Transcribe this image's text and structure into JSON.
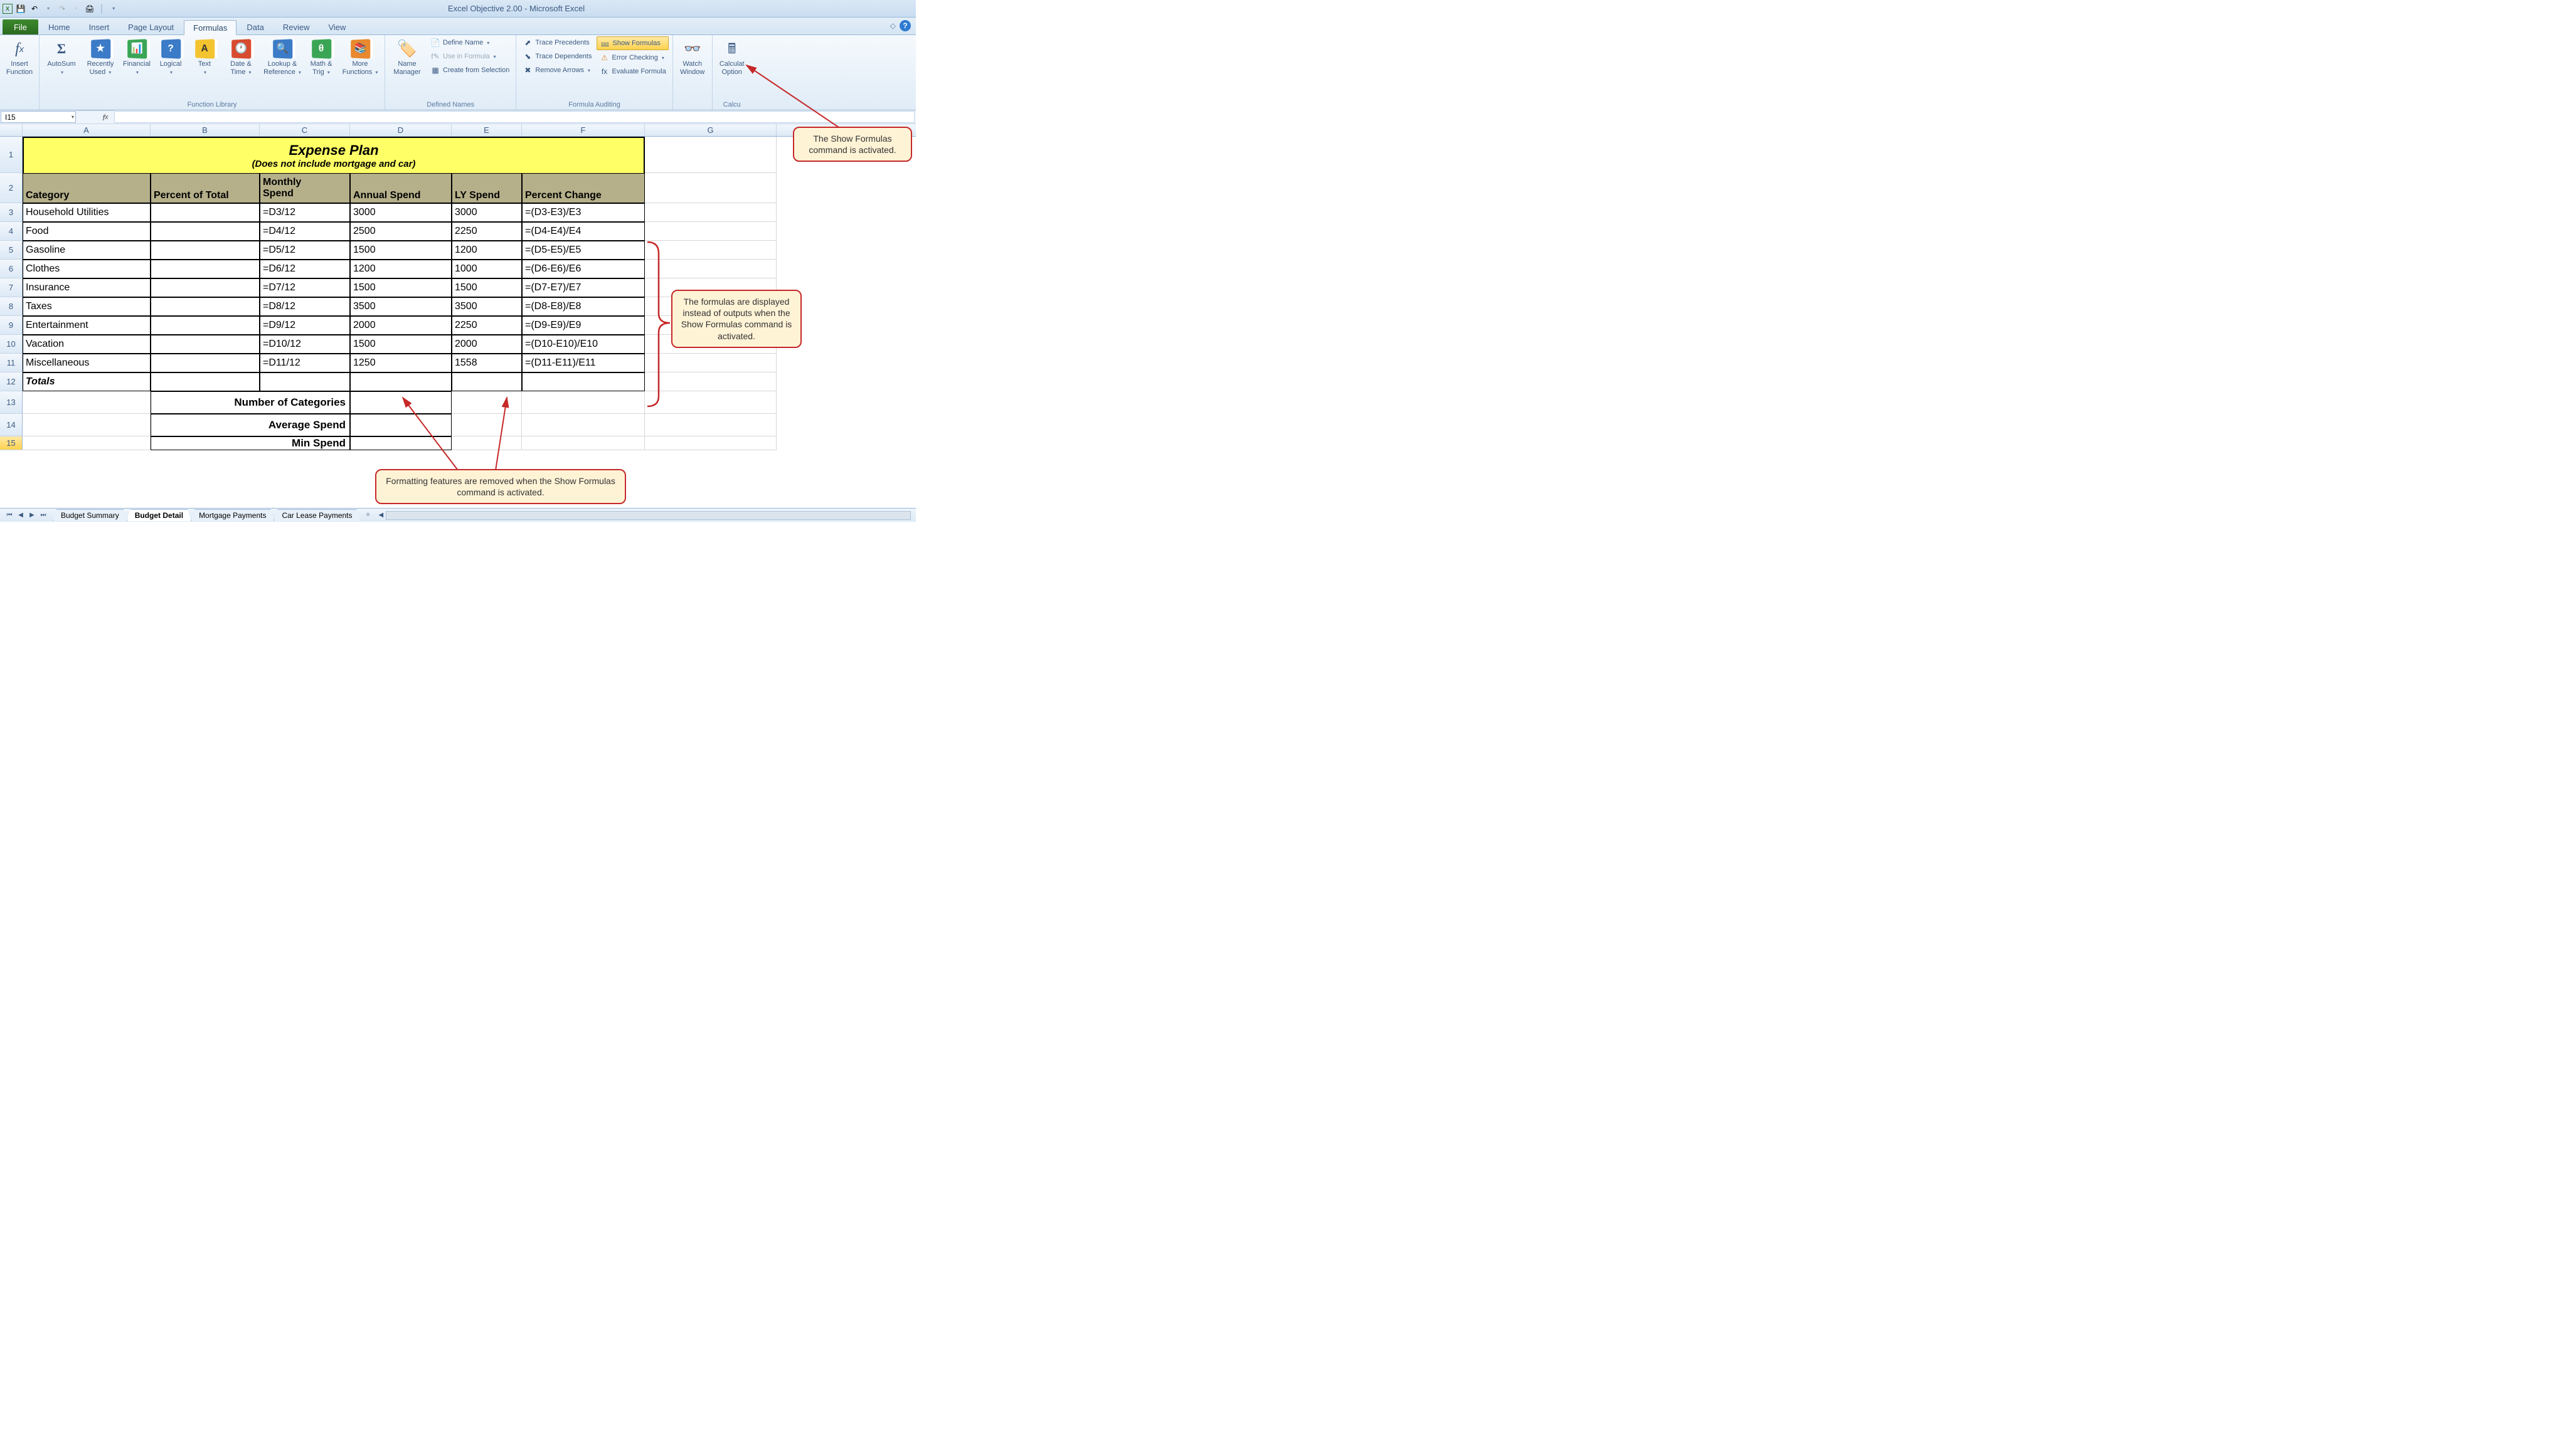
{
  "title": "Excel Objective 2.00 - Microsoft Excel",
  "qat": {
    "save": "💾",
    "undo": "↶",
    "redo": "↷",
    "print": "🖨"
  },
  "tabs": {
    "file": "File",
    "items": [
      "Home",
      "Insert",
      "Page Layout",
      "Formulas",
      "Data",
      "Review",
      "View"
    ],
    "active": "Formulas"
  },
  "ribbon": {
    "insertFn": {
      "label": "Insert\nFunction",
      "icon": "fx"
    },
    "lib": {
      "group": "Function Library",
      "autosum": "AutoSum",
      "autosum_sym": "Σ",
      "recent": "Recently\nUsed",
      "financial": "Financial",
      "logical": "Logical",
      "text": "Text",
      "datetime": "Date &\nTime",
      "lookup": "Lookup &\nReference",
      "math": "Math &\nTrig",
      "more": "More\nFunctions"
    },
    "names": {
      "group": "Defined Names",
      "mgr": "Name\nManager",
      "define": "Define Name",
      "use": "Use in Formula",
      "create": "Create from Selection"
    },
    "audit": {
      "group": "Formula Auditing",
      "prec": "Trace Precedents",
      "dep": "Trace Dependents",
      "rem": "Remove Arrows",
      "show": "Show Formulas",
      "err": "Error Checking",
      "eval": "Evaluate Formula"
    },
    "watch": {
      "label": "Watch\nWindow"
    },
    "calc": {
      "group": "Calcu",
      "opt": "Calculat\nOption"
    }
  },
  "namebox": "I15",
  "cols": [
    "A",
    "B",
    "C",
    "D",
    "E",
    "F",
    "G"
  ],
  "sheet": {
    "title": "Expense Plan",
    "subtitle": "(Does not include mortgage and car)",
    "headers": {
      "A": "Category",
      "B": "Percent of Total",
      "C1": "Monthly",
      "C2": "Spend",
      "D": "Annual Spend",
      "E": "LY Spend",
      "F": "Percent Change"
    },
    "rows": [
      {
        "n": 3,
        "A": "Household Utilities",
        "C": "=D3/12",
        "D": "3000",
        "E": "3000",
        "F": "=(D3-E3)/E3"
      },
      {
        "n": 4,
        "A": "Food",
        "C": "=D4/12",
        "D": "2500",
        "E": "2250",
        "F": "=(D4-E4)/E4"
      },
      {
        "n": 5,
        "A": "Gasoline",
        "C": "=D5/12",
        "D": "1500",
        "E": "1200",
        "F": "=(D5-E5)/E5"
      },
      {
        "n": 6,
        "A": "Clothes",
        "C": "=D6/12",
        "D": "1200",
        "E": "1000",
        "F": "=(D6-E6)/E6"
      },
      {
        "n": 7,
        "A": "Insurance",
        "C": "=D7/12",
        "D": "1500",
        "E": "1500",
        "F": "=(D7-E7)/E7"
      },
      {
        "n": 8,
        "A": "Taxes",
        "C": "=D8/12",
        "D": "3500",
        "E": "3500",
        "F": "=(D8-E8)/E8"
      },
      {
        "n": 9,
        "A": "Entertainment",
        "C": "=D9/12",
        "D": "2000",
        "E": "2250",
        "F": "=(D9-E9)/E9"
      },
      {
        "n": 10,
        "A": "Vacation",
        "C": "=D10/12",
        "D": "1500",
        "E": "2000",
        "F": "=(D10-E10)/E10"
      },
      {
        "n": 11,
        "A": "Miscellaneous",
        "C": "=D11/12",
        "D": "1250",
        "E": "1558",
        "F": "=(D11-E11)/E11"
      }
    ],
    "totals": "Totals",
    "labels": {
      "r13": "Number of Categories",
      "r14": "Average Spend",
      "r15": "Min Spend"
    }
  },
  "sheetTabs": {
    "items": [
      "Budget Summary",
      "Budget Detail",
      "Mortgage Payments",
      "Car Lease Payments"
    ],
    "active": "Budget Detail"
  },
  "callouts": {
    "c1": "The Show Formulas command is activated.",
    "c2": "The formulas are displayed instead of outputs when the Show Formulas command is activated.",
    "c3": "Formatting features are removed when the Show Formulas command is activated."
  }
}
